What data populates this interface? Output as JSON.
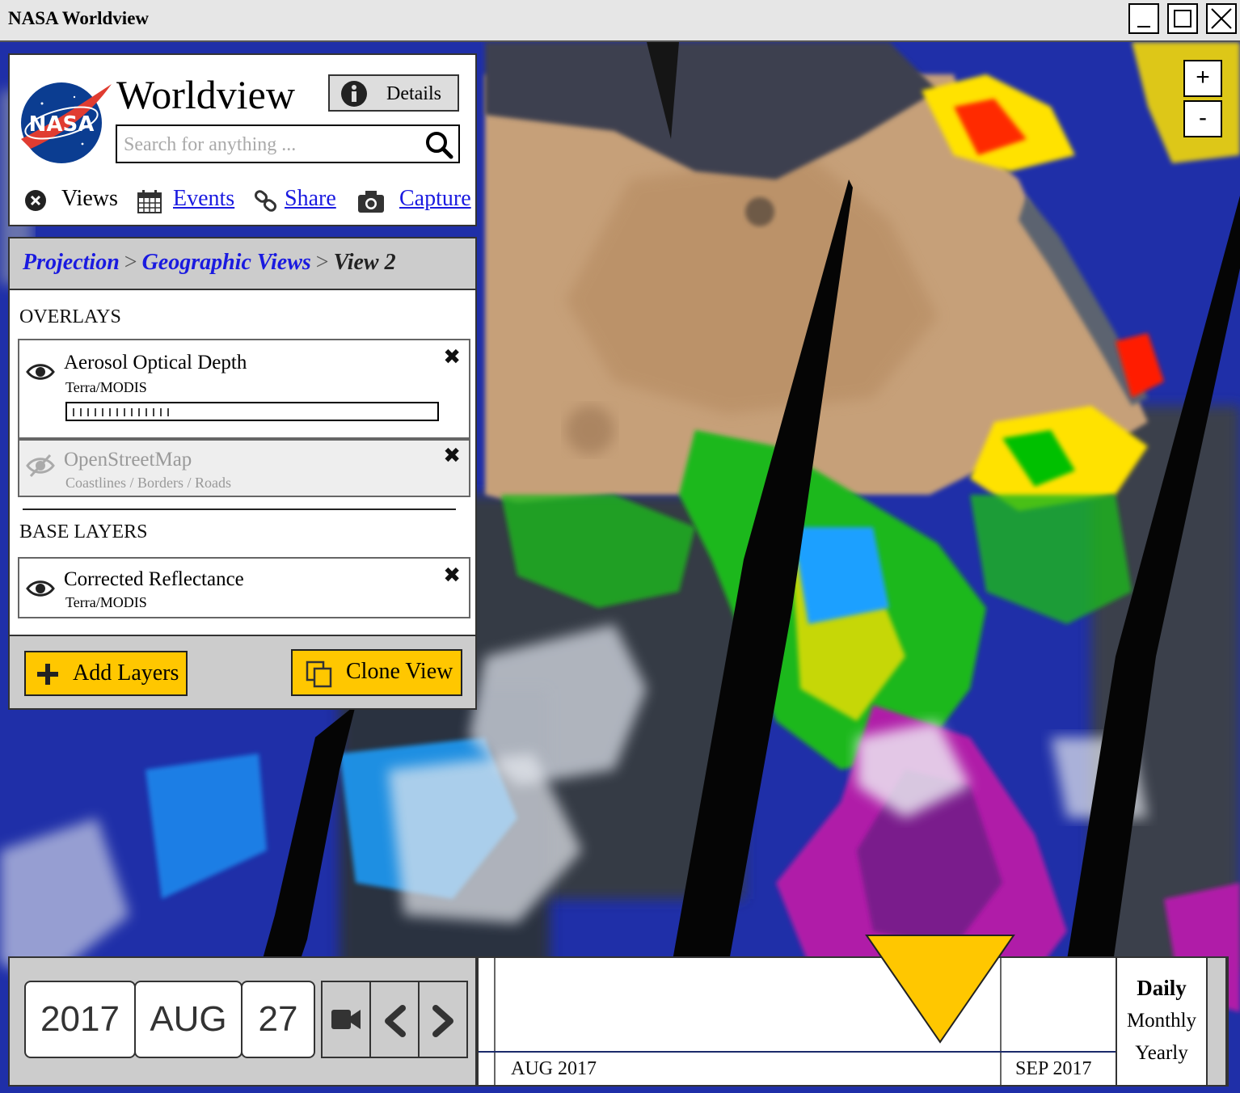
{
  "window": {
    "title": "NASA Worldview"
  },
  "app": {
    "title": "Worldview",
    "details_label": "Details",
    "search": {
      "placeholder": "Search for anything ..."
    },
    "nav": {
      "views": "Views",
      "events": "Events",
      "share": "Share",
      "capture": "Capture"
    }
  },
  "breadcrumb": {
    "projection": "Projection",
    "sep1": ">",
    "geographic_views": "Geographic Views",
    "sep2": ">",
    "current": "View 2"
  },
  "layers": {
    "overlays_heading": "OVERLAYS",
    "overlays": [
      {
        "name": "Aerosol Optical Depth",
        "source": "Terra/MODIS",
        "visible": true
      },
      {
        "name": "OpenStreetMap",
        "source": "Coastlines / Borders / Roads",
        "visible": false
      }
    ],
    "base_heading": "BASE LAYERS",
    "base": [
      {
        "name": "Corrected Reflectance",
        "source": "Terra/MODIS",
        "visible": true
      }
    ],
    "add_layers_label": "Add Layers",
    "clone_view_label": "Clone View"
  },
  "map": {
    "zoom_in": "+",
    "zoom_out": "-"
  },
  "timeline": {
    "year": "2017",
    "month": "AUG",
    "day": "27",
    "axis_labels": [
      "AUG 2017",
      "SEP 2017"
    ],
    "intervals": [
      "Daily",
      "Monthly",
      "Yearly"
    ],
    "selected_interval": "Daily"
  },
  "colors": {
    "accent": "#ffc700",
    "link": "#1a1ae0",
    "panel_gray": "#cccccc"
  },
  "icons": [
    "minimize-icon",
    "maximize-icon",
    "close-icon",
    "nasa-logo",
    "info-icon",
    "search-icon",
    "close-circle-icon",
    "calendar-icon",
    "link-icon",
    "camera-icon",
    "eye-icon",
    "eye-slash-icon",
    "remove-icon",
    "plus-icon",
    "copy-icon",
    "video-camera-icon",
    "chevron-left-icon",
    "chevron-right-icon"
  ]
}
